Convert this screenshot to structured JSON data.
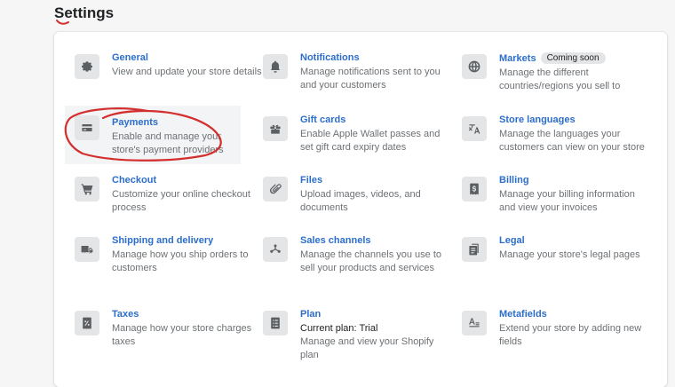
{
  "page": {
    "title": "Settings"
  },
  "settings": {
    "general": {
      "title": "General",
      "desc": "View and update your store details",
      "icon": "gear-icon"
    },
    "notifications": {
      "title": "Notifications",
      "desc": "Manage notifications sent to you and your customers",
      "icon": "bell-icon"
    },
    "markets": {
      "title": "Markets",
      "badge": "Coming soon",
      "desc": "Manage the different countries/regions you sell to",
      "icon": "globe-icon"
    },
    "payments": {
      "title": "Payments",
      "desc": "Enable and manage your store's payment providers",
      "icon": "payment-icon"
    },
    "gift_cards": {
      "title": "Gift cards",
      "desc": "Enable Apple Wallet passes and set gift card expiry dates",
      "icon": "gift-icon"
    },
    "store_languages": {
      "title": "Store languages",
      "desc": "Manage the languages your customers can view on your store",
      "icon": "translate-icon"
    },
    "checkout": {
      "title": "Checkout",
      "desc": "Customize your online checkout process",
      "icon": "cart-icon"
    },
    "files": {
      "title": "Files",
      "desc": "Upload images, videos, and documents",
      "icon": "paperclip-icon"
    },
    "billing": {
      "title": "Billing",
      "desc": "Manage your billing information and view your invoices",
      "icon": "billing-icon"
    },
    "shipping": {
      "title": "Shipping and delivery",
      "desc": "Manage how you ship orders to customers",
      "icon": "truck-icon"
    },
    "sales_channels": {
      "title": "Sales channels",
      "desc": "Manage the channels you use to sell your products and services",
      "icon": "channels-icon"
    },
    "legal": {
      "title": "Legal",
      "desc": "Manage your store's legal pages",
      "icon": "legal-icon"
    },
    "taxes": {
      "title": "Taxes",
      "desc": "Manage how your store charges taxes",
      "icon": "tax-icon"
    },
    "plan": {
      "title": "Plan",
      "current": "Current plan: Trial",
      "desc": "Manage and view your Shopify plan",
      "icon": "plan-icon"
    },
    "metafields": {
      "title": "Metafields",
      "desc": "Extend your store by adding new fields",
      "icon": "metafields-icon"
    }
  },
  "colors": {
    "link": "#2c6ecb",
    "annotation": "#d32f2f"
  }
}
